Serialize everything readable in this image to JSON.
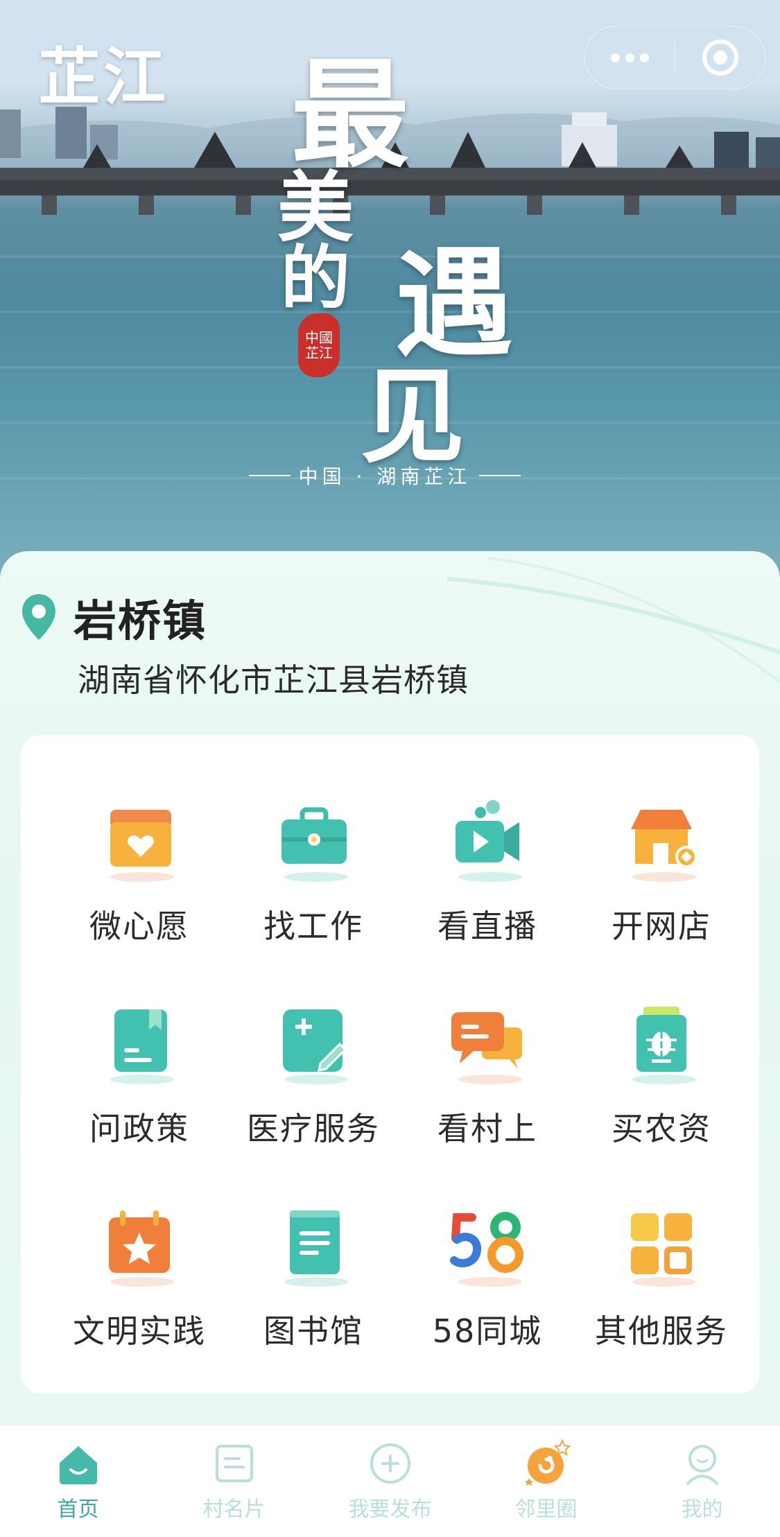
{
  "header": {
    "app_name": "芷江",
    "capsule": {
      "more_icon": "more-dots-icon",
      "close_icon": "target-close-icon"
    }
  },
  "banner": {
    "calligraphy": [
      "最",
      "美",
      "的",
      "遇",
      "见"
    ],
    "seal_text": "中國芷江",
    "subtitle": "中国 · 湖南芷江"
  },
  "location": {
    "icon": "location-pin-icon",
    "town": "岩桥镇",
    "address": "湖南省怀化市芷江县岩桥镇"
  },
  "services": [
    {
      "label": "微心愿",
      "icon": "wish-box-icon"
    },
    {
      "label": "找工作",
      "icon": "briefcase-icon"
    },
    {
      "label": "看直播",
      "icon": "video-camera-icon"
    },
    {
      "label": "开网店",
      "icon": "shop-icon"
    },
    {
      "label": "问政策",
      "icon": "policy-book-icon"
    },
    {
      "label": "医疗服务",
      "icon": "medical-note-icon"
    },
    {
      "label": "看村上",
      "icon": "chat-bubbles-icon"
    },
    {
      "label": "买农资",
      "icon": "agri-supplies-icon"
    },
    {
      "label": "文明实践",
      "icon": "calendar-star-icon"
    },
    {
      "label": "图书馆",
      "icon": "library-book-icon"
    },
    {
      "label": "58同城",
      "icon": "58-logo-icon"
    },
    {
      "label": "其他服务",
      "icon": "grid-apps-icon"
    }
  ],
  "tabbar": [
    {
      "label": "首页",
      "icon": "home-icon",
      "active": true
    },
    {
      "label": "村名片",
      "icon": "village-card-icon",
      "active": false
    },
    {
      "label": "我要发布",
      "icon": "publish-plus-icon",
      "active": false
    },
    {
      "label": "邻里圈",
      "icon": "neighbor-circle-icon",
      "active": false
    },
    {
      "label": "我的",
      "icon": "profile-icon",
      "active": false
    }
  ],
  "colors": {
    "accent": "#3aa9a3",
    "inactive_tab": "#b9dfda",
    "orange": "#f08a3c",
    "teal": "#3dbbab"
  }
}
